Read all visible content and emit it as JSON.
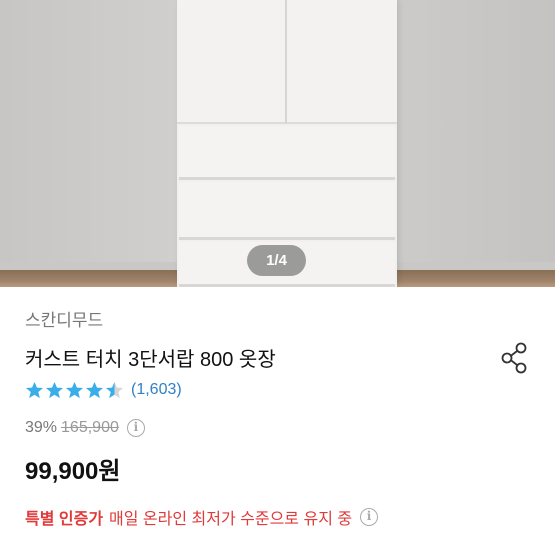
{
  "gallery": {
    "pager_text": "1/4"
  },
  "product": {
    "brand": "스칸디무드",
    "title": "커스트 터치 3단서랍 800 옷장",
    "rating": {
      "stars": 4.5,
      "count_text": "(1,603)"
    },
    "discount_text": "39%",
    "original_price": "165,900",
    "price": "99,900원",
    "promo": {
      "badge": "특별 인증가",
      "text": "매일 온라인 최저가 수준으로 유지 중"
    }
  },
  "icons": {
    "share": "share-icon",
    "info": "info-icon",
    "star": "star-icon"
  },
  "colors": {
    "star": "#3aaee8",
    "rating_count": "#2f80c8",
    "promo": "#e03a3a"
  }
}
